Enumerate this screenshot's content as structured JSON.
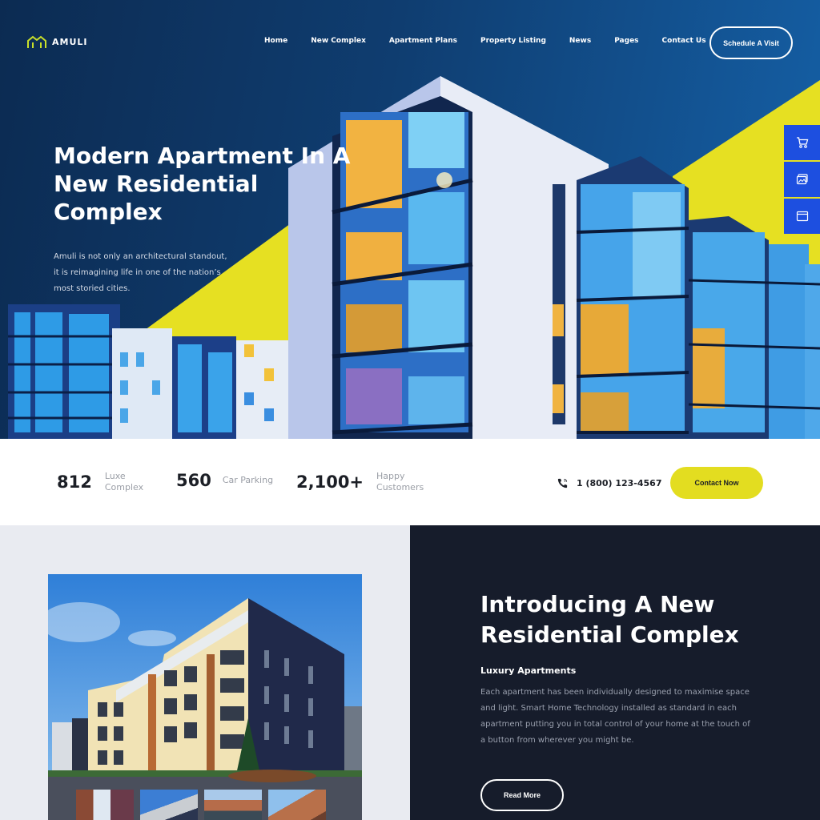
{
  "brand": {
    "name": "AMULI",
    "accent_yellow": "#e3dd20",
    "accent_blue": "#1d4fe0",
    "navy": "#161c2b"
  },
  "nav": {
    "links": [
      "Home",
      "New Complex",
      "Apartment Plans",
      "Property Listing",
      "News",
      "Pages",
      "Contact Us"
    ],
    "cta": "Schedule A Visit"
  },
  "hero": {
    "title": "Modern Apartment In A New Residential Complex",
    "description": "Amuli is not only an architectural standout, it is reimagining life in one of the nation’s most storied cities."
  },
  "side_tools": [
    {
      "icon": "cart-icon"
    },
    {
      "icon": "gallery-icon"
    },
    {
      "icon": "browser-window-icon"
    }
  ],
  "stats": [
    {
      "value": "812",
      "label_1": "Luxe",
      "label_2": "Complex"
    },
    {
      "value": "560",
      "label_1": "Car Parking",
      "label_2": ""
    },
    {
      "value": "2,100+",
      "label_1": "Happy",
      "label_2": "Customers"
    }
  ],
  "contact": {
    "phone": "1 (800) 123-4567",
    "button": "Contact Now"
  },
  "intro": {
    "title": "Introducing A New Residential Complex",
    "subtitle": "Luxury Apartments",
    "description": "Each apartment has been individually designed to maximise space and light. Smart Home Technology installed as standard in each apartment putting you in total control of your home at the touch of a button from wherever you might be.",
    "button": "Read More"
  }
}
